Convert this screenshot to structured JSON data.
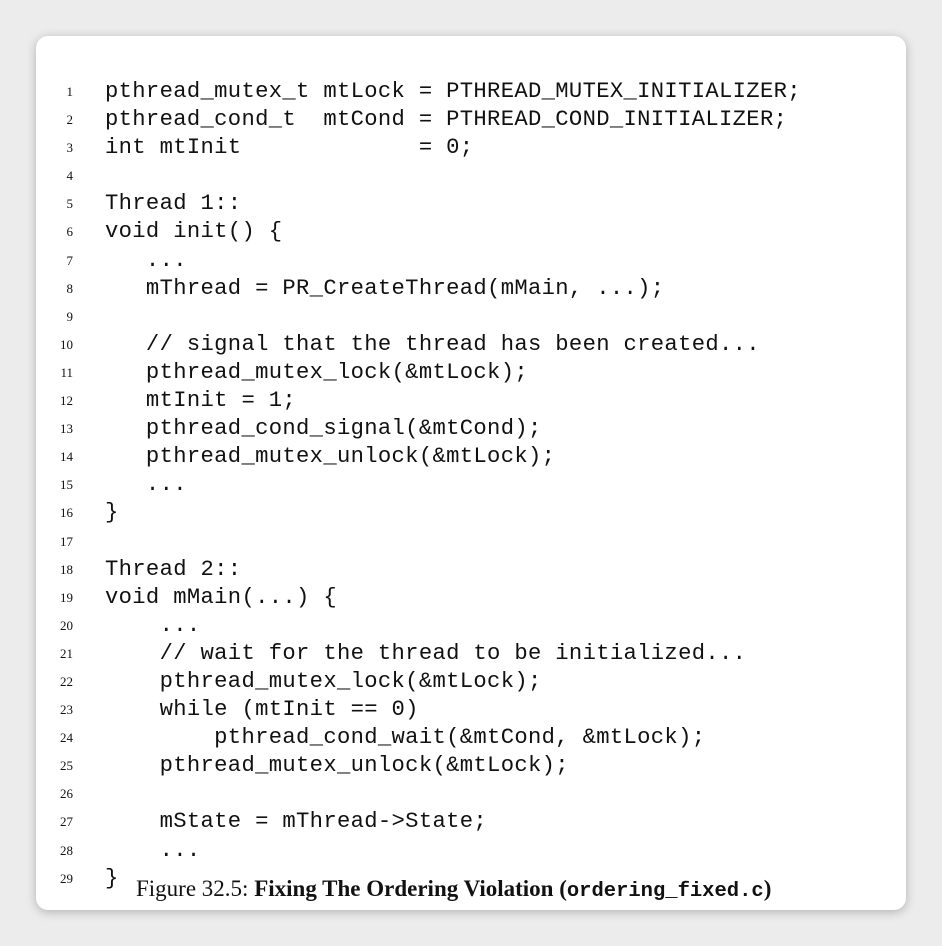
{
  "code_lines": [
    {
      "num": "1",
      "text": "pthread_mutex_t mtLock = PTHREAD_MUTEX_INITIALIZER;"
    },
    {
      "num": "2",
      "text": "pthread_cond_t  mtCond = PTHREAD_COND_INITIALIZER;"
    },
    {
      "num": "3",
      "text": "int mtInit             = 0;"
    },
    {
      "num": "4",
      "text": ""
    },
    {
      "num": "5",
      "text": "Thread 1::"
    },
    {
      "num": "6",
      "text": "void init() {"
    },
    {
      "num": "7",
      "text": "   ..."
    },
    {
      "num": "8",
      "text": "   mThread = PR_CreateThread(mMain, ...);"
    },
    {
      "num": "9",
      "text": ""
    },
    {
      "num": "10",
      "text": "   // signal that the thread has been created..."
    },
    {
      "num": "11",
      "text": "   pthread_mutex_lock(&mtLock);"
    },
    {
      "num": "12",
      "text": "   mtInit = 1;"
    },
    {
      "num": "13",
      "text": "   pthread_cond_signal(&mtCond);"
    },
    {
      "num": "14",
      "text": "   pthread_mutex_unlock(&mtLock);"
    },
    {
      "num": "15",
      "text": "   ..."
    },
    {
      "num": "16",
      "text": "}"
    },
    {
      "num": "17",
      "text": ""
    },
    {
      "num": "18",
      "text": "Thread 2::"
    },
    {
      "num": "19",
      "text": "void mMain(...) {"
    },
    {
      "num": "20",
      "text": "    ..."
    },
    {
      "num": "21",
      "text": "    // wait for the thread to be initialized..."
    },
    {
      "num": "22",
      "text": "    pthread_mutex_lock(&mtLock);"
    },
    {
      "num": "23",
      "text": "    while (mtInit == 0)"
    },
    {
      "num": "24",
      "text": "        pthread_cond_wait(&mtCond, &mtLock);"
    },
    {
      "num": "25",
      "text": "    pthread_mutex_unlock(&mtLock);"
    },
    {
      "num": "26",
      "text": ""
    },
    {
      "num": "27",
      "text": "    mState = mThread->State;"
    },
    {
      "num": "28",
      "text": "    ..."
    },
    {
      "num": "29",
      "text": "}"
    }
  ],
  "caption": {
    "label": "Figure 32.5:",
    "title": "Fixing The Ordering Violation (",
    "filename": "ordering_fixed.c",
    "close": ")"
  }
}
